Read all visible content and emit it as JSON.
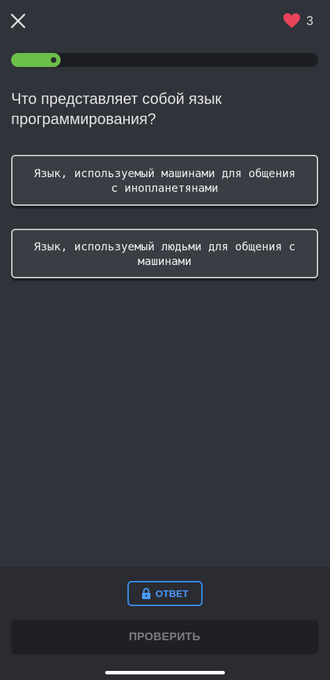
{
  "header": {
    "close_icon": "close-icon",
    "lives_count": "3",
    "heart_icon": "heart-icon",
    "heart_color": "#e8445a"
  },
  "progress": {
    "fraction": 0.16,
    "color": "#6cc04a"
  },
  "question": {
    "text": "Что представляет собой язык программирования?"
  },
  "options": [
    {
      "text": "Язык, используемый машинами для общения с инопланетянами"
    },
    {
      "text": "Язык, используемый людьми для общения с машинами"
    }
  ],
  "bottom": {
    "answer_label": "ОТВЕТ",
    "answer_color": "#4a9bff",
    "lock_icon": "lock-icon",
    "check_label": "ПРОВЕРИТЬ"
  }
}
